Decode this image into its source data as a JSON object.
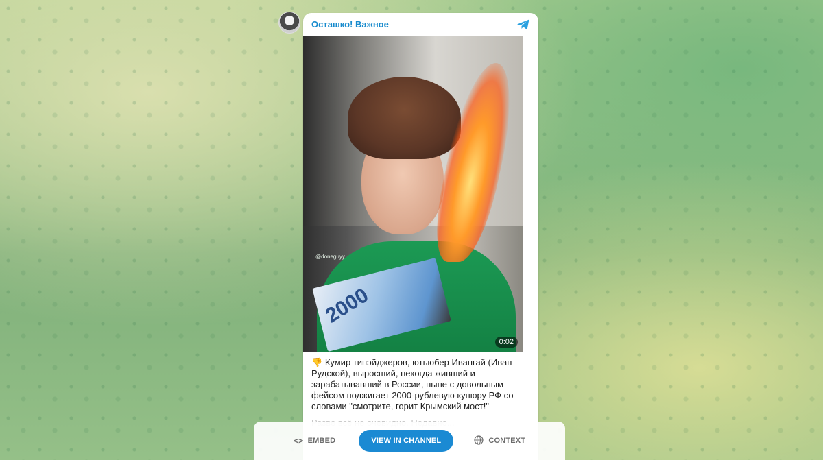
{
  "channel": {
    "name": "Осташко! Важное"
  },
  "post": {
    "video_duration": "0:02",
    "banknote_text": "2000",
    "video_watermark": "@doneguyy",
    "caption_emoji": "👎",
    "caption_text": "Кумир тинэйджеров, ютьюбер Ивангай (Иван Рудской), выросший, некогда живший и зарабатывавший в России, ныне с довольным фейсом поджигает 2000-рублевую купюру РФ со словами \"смотрите, горит Крымский мост!\"",
    "caption_faded": "Разве всё не очевидно. Недавно..."
  },
  "bottom_bar": {
    "embed_label": "EMBED",
    "view_label": "VIEW IN CHANNEL",
    "context_label": "CONTEXT"
  },
  "colors": {
    "accent": "#168acd",
    "button": "#1b8ad3"
  }
}
